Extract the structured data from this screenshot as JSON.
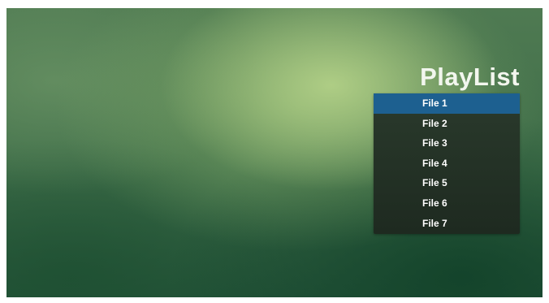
{
  "playlist": {
    "title": "PlayList",
    "selected_index": 0,
    "items": [
      {
        "label": "File 1"
      },
      {
        "label": "File 2"
      },
      {
        "label": "File 3"
      },
      {
        "label": "File 4"
      },
      {
        "label": "File 5"
      },
      {
        "label": "File 6"
      },
      {
        "label": "File 7"
      }
    ]
  },
  "colors": {
    "selection": "#1d6090",
    "panel": "#1e2a20",
    "text": "#ffffff"
  }
}
